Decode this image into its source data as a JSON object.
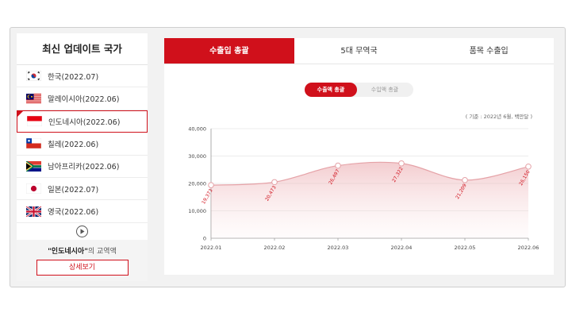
{
  "sidebar": {
    "title": "최신 업데이트 국가",
    "countries": [
      {
        "label": "한국(2022.07)"
      },
      {
        "label": "말레이시아(2022.06)"
      },
      {
        "label": "인도네시아(2022.06)"
      },
      {
        "label": "칠레(2022.06)"
      },
      {
        "label": "남아프리카(2022.06)"
      },
      {
        "label": "일본(2022.07)"
      },
      {
        "label": "영국(2022.06)"
      }
    ],
    "trade_caption_country": "\"인도네시아\"",
    "trade_caption_suffix": "의 교역액",
    "detail_button": "상세보기"
  },
  "tabs": [
    {
      "label": "수출입 총괄"
    },
    {
      "label": "5대 무역국"
    },
    {
      "label": "품목 수출입"
    }
  ],
  "toggle": {
    "export_label": "수출액 총괄",
    "import_label": "수입액 총괄"
  },
  "basis_note": "( 기준 : 2022년 6월, 백만달 )",
  "colors": {
    "accent": "#d0101b",
    "line": "#e5a2a7"
  },
  "chart_data": {
    "type": "area",
    "categories": [
      "2022.01",
      "2022.02",
      "2022.03",
      "2022.04",
      "2022.05",
      "2022.06"
    ],
    "series": [
      {
        "values": [
          19373,
          20473,
          26497,
          27322,
          21209,
          26150
        ]
      }
    ],
    "data_labels": [
      "19,373",
      "20,473",
      "26,497",
      "27,322",
      "21,209",
      "26,150"
    ],
    "yticks": [
      "0",
      "10,000",
      "20,000",
      "30,000",
      "40,000"
    ],
    "ylim": [
      0,
      40000
    ],
    "grid": true
  }
}
